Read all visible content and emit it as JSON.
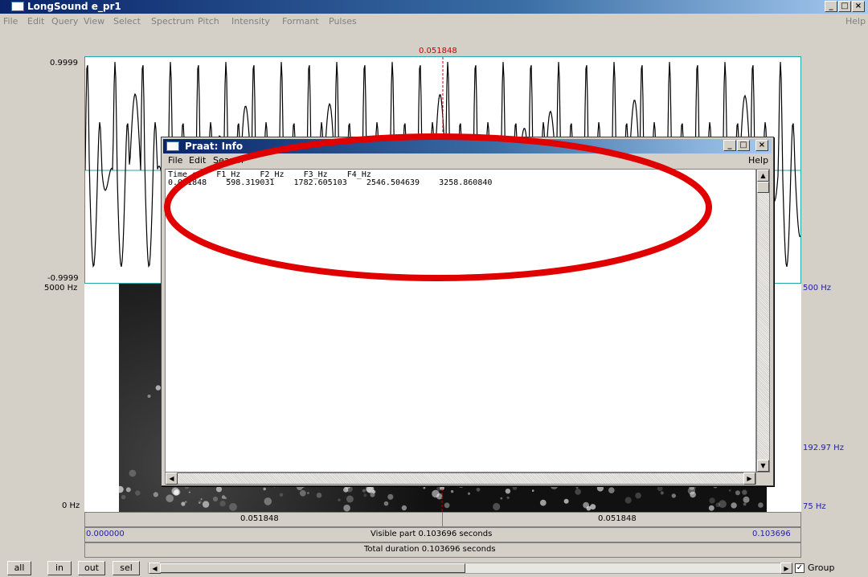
{
  "main_window": {
    "title": "LongSound e_pr1",
    "controls": [
      "_",
      "□",
      "×"
    ],
    "menu": [
      "File",
      "Edit",
      "Query",
      "View",
      "Select",
      "Spectrum",
      "Pitch",
      "Intensity",
      "Formant",
      "Pulses"
    ],
    "help": "Help"
  },
  "editor": {
    "cursor_time": "0.051848",
    "wave_top": "0.9999",
    "wave_bottom": "-0.9999",
    "spec_top_left": "5000 Hz",
    "spec_bottom_left": "0 Hz",
    "right_top": "500 Hz",
    "right_mid": "192.97 Hz",
    "right_bottom": "75 Hz",
    "tier1_left": "0.051848",
    "tier1_right": "0.051848",
    "tier2_start": "0.000000",
    "tier2_mid": "Visible part 0.103696 seconds",
    "tier2_end": "0.103696",
    "tier3": "Total duration 0.103696 seconds"
  },
  "bottom": {
    "all": "all",
    "in": "in",
    "out": "out",
    "sel": "sel",
    "group": "Group",
    "group_checked": true
  },
  "info_window": {
    "title": "Praat: Info",
    "menu": [
      "File",
      "Edit",
      "Search"
    ],
    "help": "Help",
    "header": "Time_s    F1_Hz    F2_Hz    F3_Hz    F4_Hz",
    "row": "0.051848    598.319031    1782.605103    2546.504639    3258.860840"
  },
  "colors": {
    "titlebar": "#0a246a",
    "annotation": "#e00000",
    "cursor": "#cc0000"
  }
}
